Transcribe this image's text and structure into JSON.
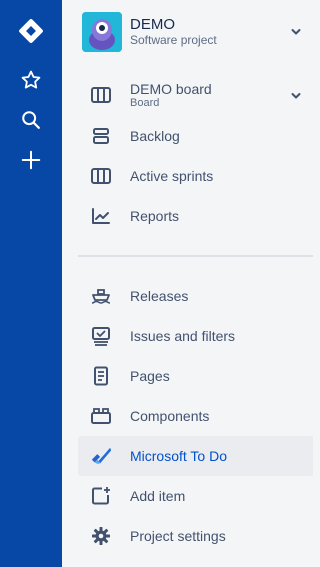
{
  "global_nav": {
    "items": [
      {
        "name": "jira-logo",
        "icon": "jira-diamond-icon"
      },
      {
        "name": "starred",
        "icon": "star-icon"
      },
      {
        "name": "search",
        "icon": "search-icon"
      },
      {
        "name": "create",
        "icon": "plus-icon"
      }
    ]
  },
  "project": {
    "name": "DEMO",
    "type": "Software project"
  },
  "board": {
    "name": "DEMO board",
    "subtitle": "Board"
  },
  "planning_items": [
    {
      "label": "Backlog",
      "icon": "backlog-icon"
    },
    {
      "label": "Active sprints",
      "icon": "active-sprints-icon"
    },
    {
      "label": "Reports",
      "icon": "reports-icon"
    }
  ],
  "development_items": [
    {
      "label": "Releases",
      "icon": "ship-icon"
    },
    {
      "label": "Issues and filters",
      "icon": "issues-icon"
    },
    {
      "label": "Pages",
      "icon": "page-icon"
    },
    {
      "label": "Components",
      "icon": "components-icon"
    },
    {
      "label": "Microsoft To Do",
      "icon": "microsoft-todo-icon",
      "selected": true
    },
    {
      "label": "Add item",
      "icon": "add-item-icon"
    },
    {
      "label": "Project settings",
      "icon": "gear-icon"
    }
  ],
  "colors": {
    "rail": "#0747A6",
    "sidebar_bg": "#F4F5F7",
    "text": "#42526E",
    "selected_text": "#0052CC",
    "avatar_bg": "#22B7D9"
  }
}
